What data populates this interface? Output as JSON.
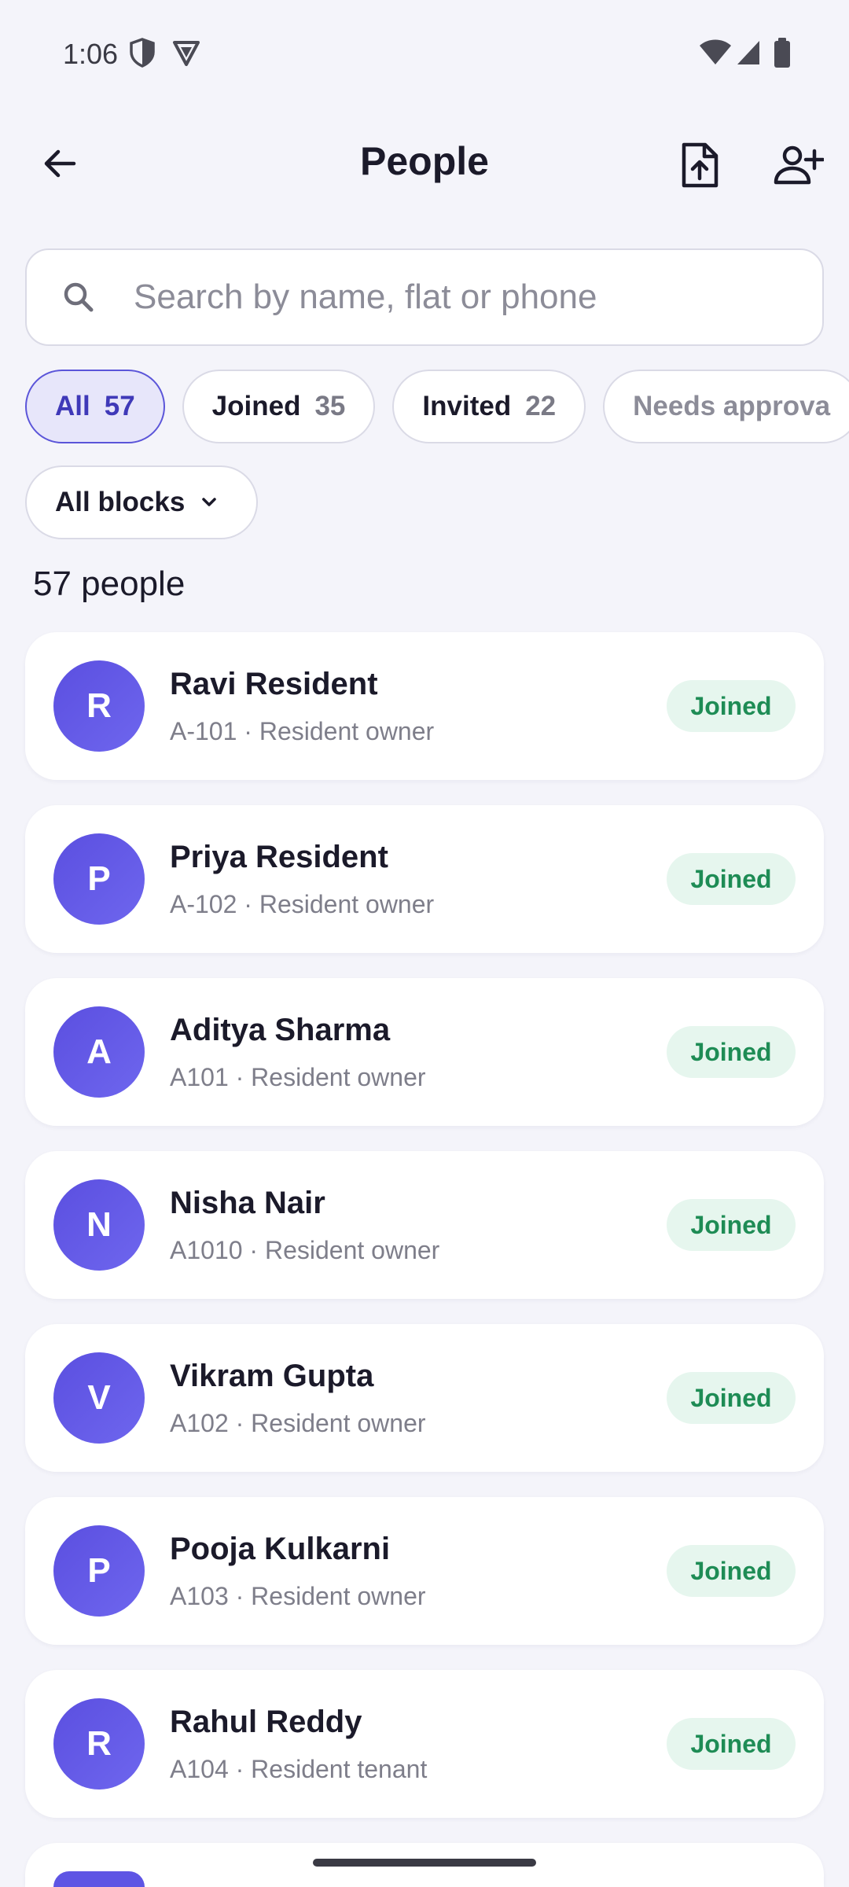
{
  "status_bar": {
    "time": "1:06"
  },
  "header": {
    "title": "People"
  },
  "search": {
    "placeholder": "Search by name, flat or phone",
    "value": ""
  },
  "filters": {
    "chips": [
      {
        "label": "All",
        "count": "57"
      },
      {
        "label": "Joined",
        "count": "35"
      },
      {
        "label": "Invited",
        "count": "22"
      },
      {
        "label": "Needs approva",
        "count": ""
      }
    ],
    "block_filter": "All blocks"
  },
  "summary": {
    "count_text": "57 people"
  },
  "people": [
    {
      "initial": "R",
      "name": "Ravi Resident",
      "sub": "A-101 · Resident owner",
      "status": "Joined"
    },
    {
      "initial": "P",
      "name": "Priya Resident",
      "sub": "A-102 · Resident owner",
      "status": "Joined"
    },
    {
      "initial": "A",
      "name": "Aditya Sharma",
      "sub": "A101 · Resident owner",
      "status": "Joined"
    },
    {
      "initial": "N",
      "name": "Nisha Nair",
      "sub": "A1010 · Resident owner",
      "status": "Joined"
    },
    {
      "initial": "V",
      "name": "Vikram Gupta",
      "sub": "A102 · Resident owner",
      "status": "Joined"
    },
    {
      "initial": "P",
      "name": "Pooja Kulkarni",
      "sub": "A103 · Resident owner",
      "status": "Joined"
    },
    {
      "initial": "R",
      "name": "Rahul Reddy",
      "sub": "A104 · Resident tenant",
      "status": "Joined"
    }
  ],
  "colors": {
    "accent": "#5B55D9",
    "avatar": "#6258E6",
    "joined_text": "#1E8C55",
    "joined_bg": "#E6F6EE",
    "background": "#F4F4FA"
  },
  "icons": {
    "back": "arrow-left-icon",
    "upload": "file-upload-icon",
    "add_user": "person-add-icon",
    "search": "search-icon",
    "dropdown": "chevron-down-icon"
  }
}
